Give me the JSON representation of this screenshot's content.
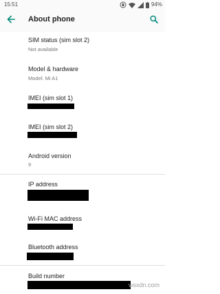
{
  "status_bar": {
    "time": "15:51",
    "battery_text": "94%",
    "icons": [
      "vibrate-icon",
      "wifi-icon",
      "signal-icon",
      "battery-icon"
    ]
  },
  "toolbar": {
    "title": "About phone",
    "back_icon": "arrow-back-icon",
    "search_icon": "search-icon",
    "accent": "#00897b"
  },
  "items": [
    {
      "label": "SIM status (sim slot 2)",
      "summary": "Not available"
    },
    {
      "label": "Model & hardware",
      "summary": "Model: Mi A1"
    },
    {
      "label": "IMEI (sim slot 1)",
      "summary": ""
    },
    {
      "label": "IMEI (sim slot 2)",
      "summary": ""
    },
    {
      "label": "Android version",
      "summary": "9"
    },
    {
      "label": "IP address",
      "summary": ""
    },
    {
      "label": "Wi-Fi MAC address",
      "summary": ""
    },
    {
      "label": "Bluetooth address",
      "summary": ""
    },
    {
      "label": "Build number",
      "summary": ""
    }
  ],
  "watermark": "wsxdn.com"
}
